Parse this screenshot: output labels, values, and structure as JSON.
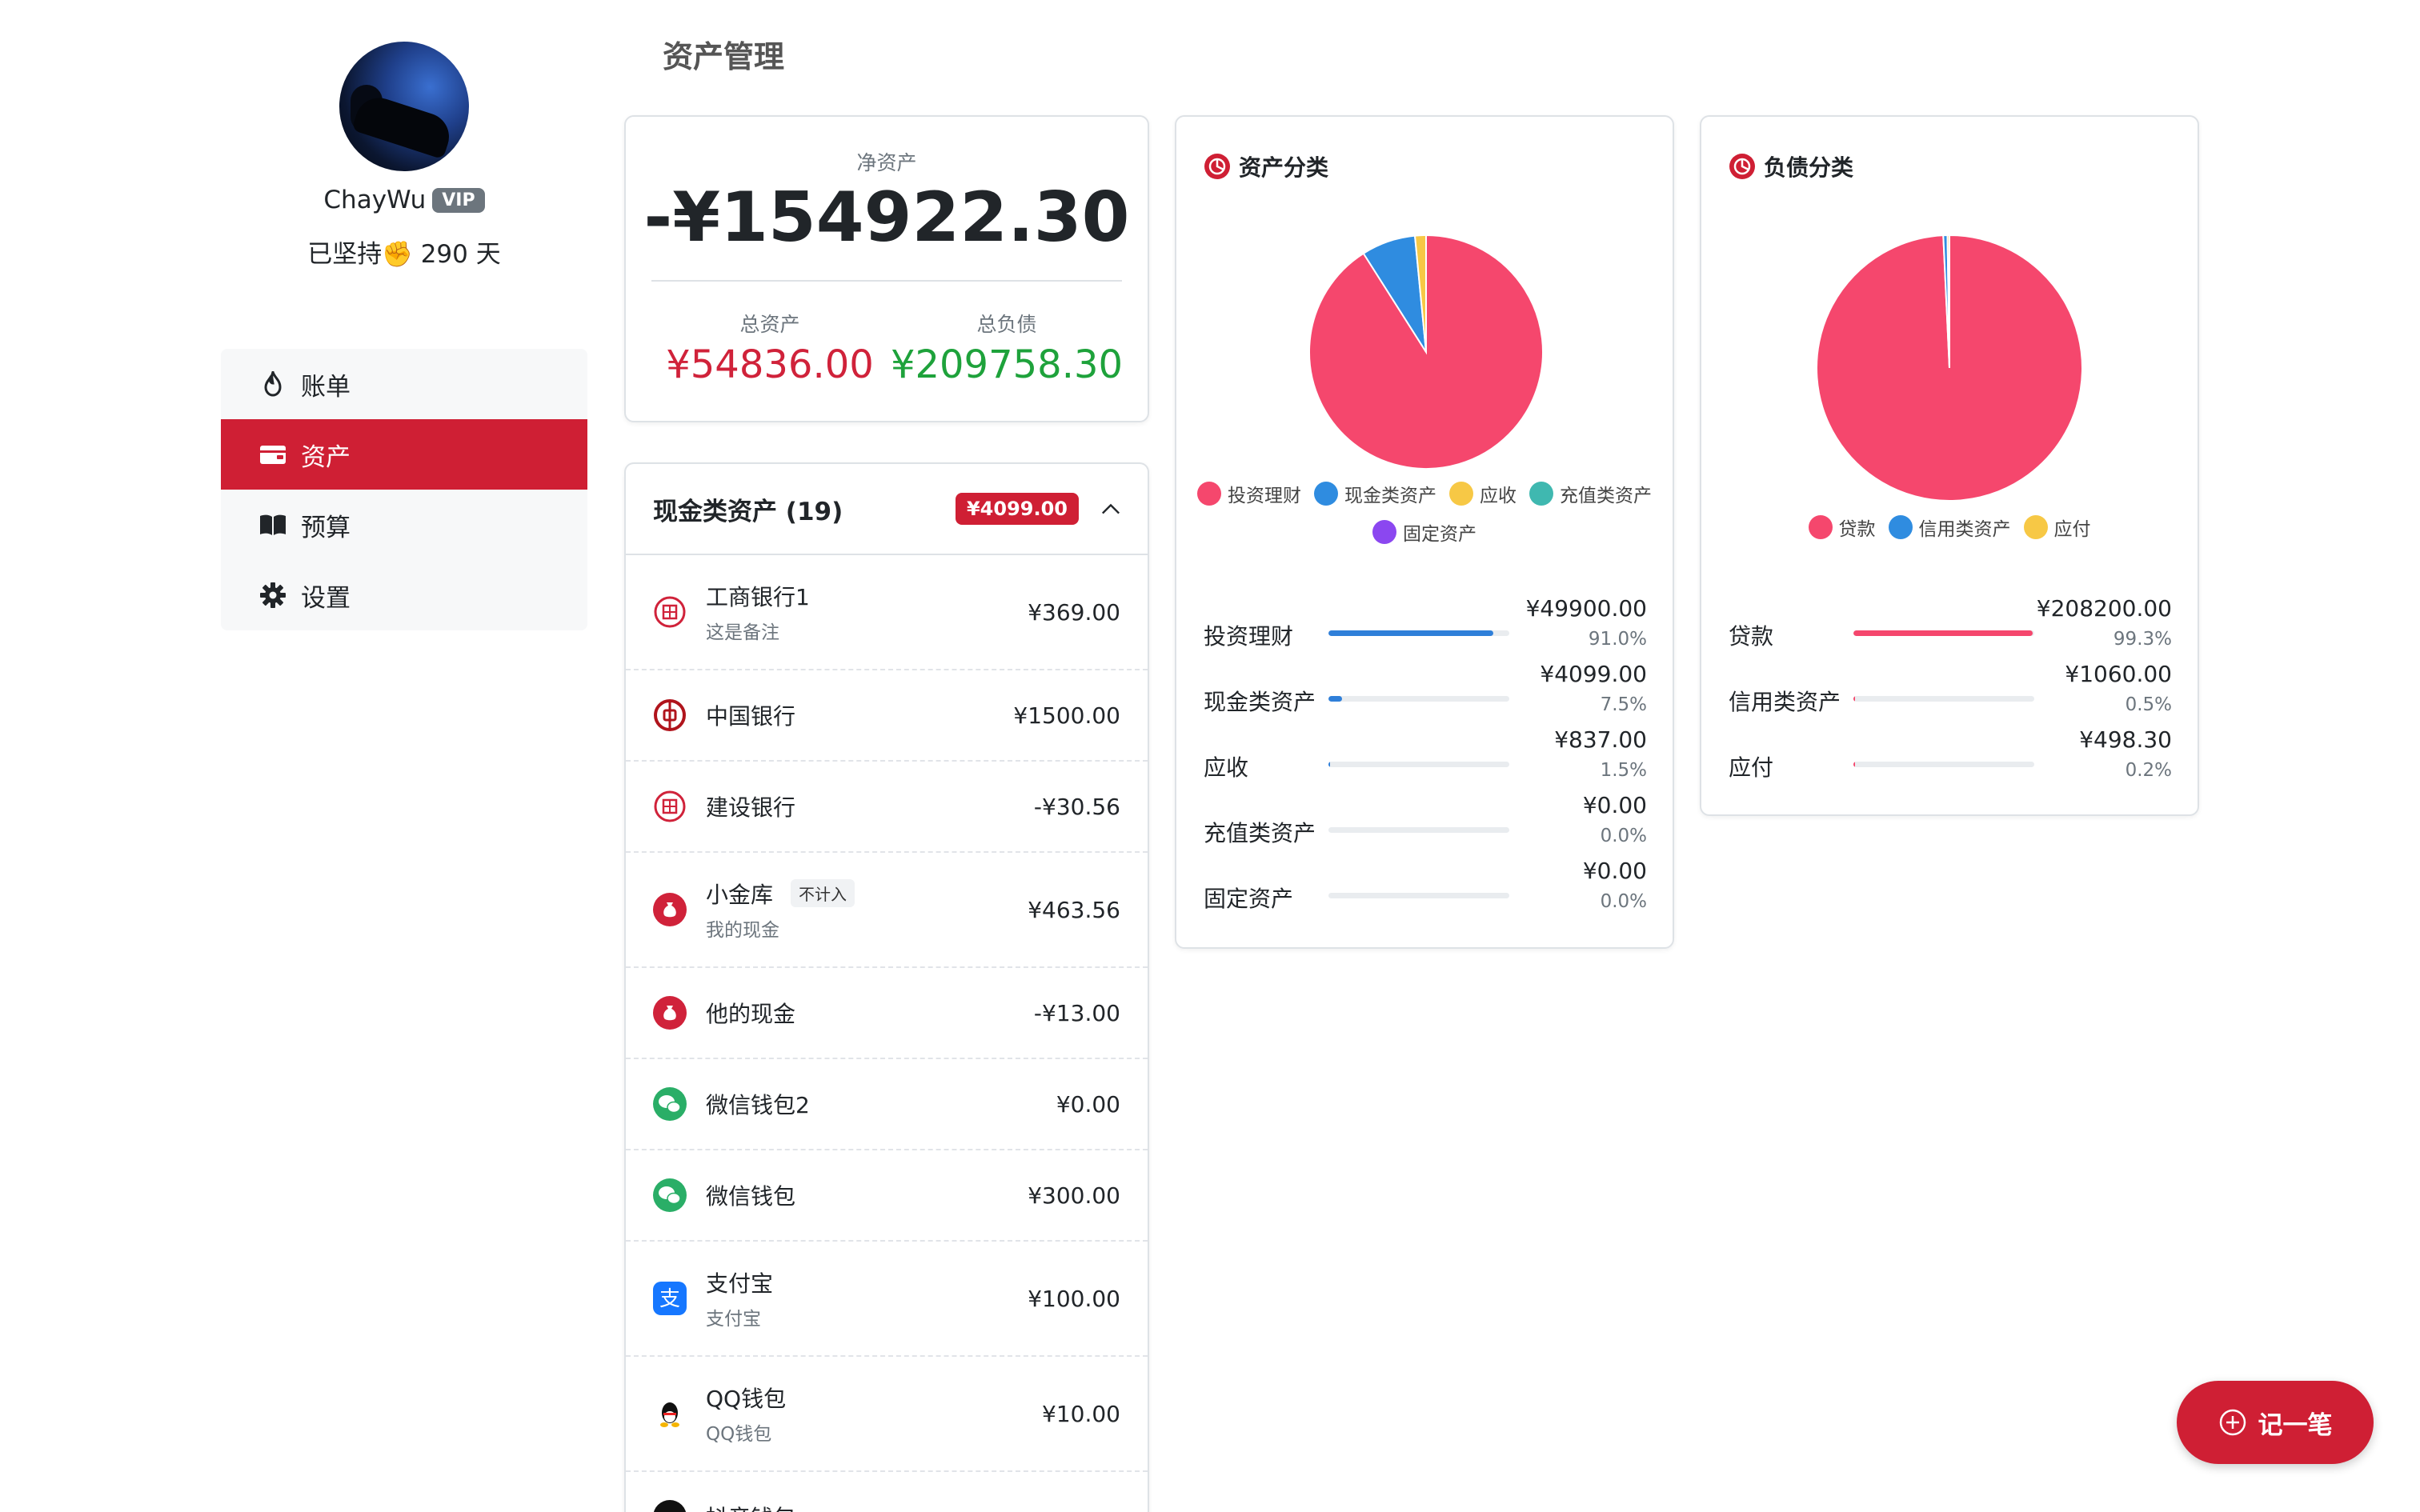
{
  "user": {
    "name": "ChayWu",
    "badge": "VIP",
    "streak": "已坚持✊ 290 天"
  },
  "nav": [
    {
      "label": "账单",
      "icon": "fire-icon",
      "active": false
    },
    {
      "label": "资产",
      "icon": "wallet-icon",
      "active": true
    },
    {
      "label": "预算",
      "icon": "book-icon",
      "active": false
    },
    {
      "label": "设置",
      "icon": "gear-icon",
      "active": false
    }
  ],
  "page": {
    "title": "资产管理"
  },
  "summary": {
    "net_label": "净资产",
    "net_value": "-¥154922.30",
    "assets_label": "总资产",
    "assets_value": "¥54836.00",
    "liab_label": "总负债",
    "liab_value": "¥209758.30"
  },
  "cash": {
    "title": "现金类资产 (19)",
    "total": "¥4099.00",
    "accounts": [
      {
        "name": "工商银行1",
        "note": "这是备注",
        "amount": "¥369.00",
        "icon": "icbc-bank-icon",
        "color": "#d0223a"
      },
      {
        "name": "中国银行",
        "note": "",
        "amount": "¥1500.00",
        "icon": "boc-bank-icon",
        "color": "#b0141c"
      },
      {
        "name": "建设银行",
        "note": "",
        "amount": "-¥30.56",
        "icon": "ccb-bank-icon",
        "color": "#d0223a"
      },
      {
        "name": "小金库",
        "tag": "不计入",
        "note": "我的现金",
        "amount": "¥463.56",
        "icon": "cash-bag-icon",
        "color": "#d0223a"
      },
      {
        "name": "他的现金",
        "note": "",
        "amount": "-¥13.00",
        "icon": "cash-bag-icon",
        "color": "#d0223a"
      },
      {
        "name": "微信钱包2",
        "note": "",
        "amount": "¥0.00",
        "icon": "wechat-icon",
        "color": "#2aae67"
      },
      {
        "name": "微信钱包",
        "note": "",
        "amount": "¥300.00",
        "icon": "wechat-icon",
        "color": "#2aae67"
      },
      {
        "name": "支付宝",
        "note": "支付宝",
        "amount": "¥100.00",
        "icon": "alipay-icon",
        "color": "#1677ff"
      },
      {
        "name": "QQ钱包",
        "note": "QQ钱包",
        "amount": "¥10.00",
        "icon": "qq-icon",
        "color": "#111111"
      },
      {
        "name": "抖音钱包",
        "note": "",
        "amount": "",
        "icon": "douyin-icon",
        "color": "#111111"
      }
    ]
  },
  "asset_chart": {
    "title": "资产分类",
    "chart_data": {
      "type": "pie",
      "categories": [
        "投资理财",
        "现金类资产",
        "应收",
        "充值类资产",
        "固定资产"
      ],
      "values": [
        49900.0,
        4099.0,
        837.0,
        0.0,
        0.0
      ],
      "colors": [
        "#f5476d",
        "#2f8ce0",
        "#f7c845",
        "#3fb8b0",
        "#8b47f0"
      ]
    },
    "rows": [
      {
        "label": "投资理财",
        "value": "¥49900.00",
        "pct": "91.0%",
        "frac": 0.91,
        "color": "#2f7fd9"
      },
      {
        "label": "现金类资产",
        "value": "¥4099.00",
        "pct": "7.5%",
        "frac": 0.075,
        "color": "#2f7fd9"
      },
      {
        "label": "应收",
        "value": "¥837.00",
        "pct": "1.5%",
        "frac": 0.015,
        "color": "#2f7fd9"
      },
      {
        "label": "充值类资产",
        "value": "¥0.00",
        "pct": "0.0%",
        "frac": 0,
        "color": "#2f7fd9"
      },
      {
        "label": "固定资产",
        "value": "¥0.00",
        "pct": "0.0%",
        "frac": 0,
        "color": "#2f7fd9"
      }
    ]
  },
  "liab_chart": {
    "title": "负债分类",
    "chart_data": {
      "type": "pie",
      "categories": [
        "贷款",
        "信用类资产",
        "应付"
      ],
      "values": [
        208200.0,
        1060.0,
        498.3
      ],
      "colors": [
        "#f5476d",
        "#2f8ce0",
        "#f7c845"
      ]
    },
    "rows": [
      {
        "label": "贷款",
        "value": "¥208200.00",
        "pct": "99.3%",
        "frac": 0.993,
        "color": "#f5476d"
      },
      {
        "label": "信用类资产",
        "value": "¥1060.00",
        "pct": "0.5%",
        "frac": 0.005,
        "color": "#f5476d"
      },
      {
        "label": "应付",
        "value": "¥498.30",
        "pct": "0.2%",
        "frac": 0.002,
        "color": "#f5476d"
      }
    ]
  },
  "fab": {
    "label": "记一笔"
  }
}
